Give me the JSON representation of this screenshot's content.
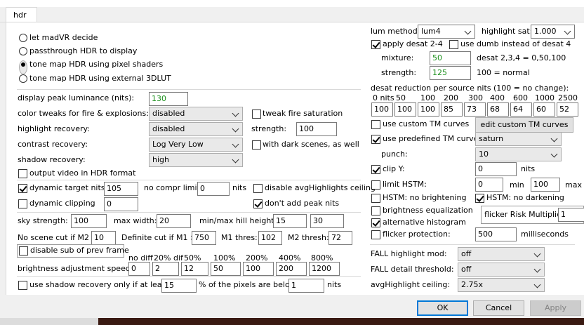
{
  "tab": {
    "label": "hdr"
  },
  "hdr_mode": {
    "options": [
      "let madVR decide",
      "passthrough HDR to display",
      "tone map HDR using pixel shaders",
      "tone map HDR using external 3DLUT"
    ],
    "selected_index": 2
  },
  "left": {
    "peak_label": "display peak luminance (nits):",
    "peak_value": "130",
    "color_tweaks_label": "color tweaks for fire & explosions:",
    "color_tweaks_value": "disabled",
    "tweak_fire_label": "tweak fire saturation",
    "highlight_label": "highlight recovery:",
    "highlight_value": "disabled",
    "strength_label": "strength:",
    "strength_value": "100",
    "contrast_label": "contrast recovery:",
    "contrast_value": "Log Very Low",
    "dark_scenes_label": "with dark scenes, as well",
    "shadow_label": "shadow recovery:",
    "shadow_value": "high",
    "output_hdr_label": "output video in HDR format",
    "dynamic_target_label": "dynamic target nits",
    "dynamic_target_value": "105",
    "no_compr_label": "no compr limit:",
    "no_compr_value": "0",
    "nits_label": "nits",
    "disable_avg_label": "disable avgHighlights ceiling",
    "dynamic_clipping_label": "dynamic clipping",
    "dynamic_clipping_value": "0",
    "dont_add_label": "don't add peak nits",
    "sky_label": "sky strength:",
    "sky_value": "100",
    "max_width_label": "max width:",
    "max_width_value": "20",
    "hill_label": "min/max hill height:",
    "hill_min": "15",
    "hill_max": "30",
    "no_scene_label": "No scene cut if M2 <",
    "no_scene_value": "10",
    "definite_label": "Definite cut if M1 >",
    "definite_value": "750",
    "m1_label": "M1 thres:",
    "m1_value": "102",
    "m2_label": "M2 thresh:",
    "m2_value": "72",
    "disable_sub_label": "disable sub of prev frame",
    "brightness_label": "brightness adjustment speeds:",
    "speed_headers": [
      "no diff",
      "20% dif",
      "50%",
      "100%",
      "200%",
      "400%",
      "800%"
    ],
    "speed_values": [
      "0",
      "2",
      "12",
      "50",
      "100",
      "200",
      "1200"
    ],
    "shadow_only_label": "use shadow recovery only if at least:",
    "shadow_only_value": "15",
    "pixels_below_label": "% of the pixels are below",
    "pixels_below_value": "1",
    "pixels_nits_label": "nits"
  },
  "right": {
    "lum_label": "lum method:",
    "lum_value": "lum4",
    "highlight_sat_label": "highlight sat:",
    "highlight_sat_value": "1.000",
    "apply_desat_label": "apply desat 2-4",
    "use_dumb_label": "use dumb instead of desat 4",
    "mixture_label": "mixture:",
    "mixture_value": "50",
    "desat_note": "desat 2,3,4 = 0,50,100",
    "strength_label": "strength:",
    "strength_value": "125",
    "normal_note": "100 = normal",
    "desat_reduction_label": "desat reduction per source nits (100 = no change):",
    "nits_headers": [
      "0 nits",
      "50",
      "100",
      "200",
      "300",
      "400",
      "600",
      "1000",
      "2500"
    ],
    "nits_values": [
      "100",
      "100",
      "100",
      "85",
      "73",
      "68",
      "64",
      "60",
      "52"
    ],
    "custom_tm_label": "use custom TM curves",
    "edit_custom_label": "edit custom TM curves",
    "predefined_label": "use predefined TM curve",
    "predefined_value": "saturn",
    "punch_label": "punch:",
    "punch_value": "10",
    "clip_label": "clip Y:",
    "clip_value": "0",
    "clip_nits": "nits",
    "limit_hstm_label": "limit HSTM:",
    "limit_hstm_value": "0",
    "min_label": "min",
    "limit_max_value": "100",
    "max_label": "max",
    "no_bright_label": "HSTM: no brightening",
    "no_dark_label": "HSTM: no darkening",
    "bright_eq_label": "brightness equalization",
    "flicker_risk_label": "flicker Risk Multiplier:",
    "flicker_risk_value": "1",
    "alt_hist_label": "alternative histogram",
    "flicker_prot_label": "flicker protection:",
    "flicker_prot_value": "500",
    "ms_label": "milliseconds",
    "fall_highlight_label": "FALL highlight mod:",
    "fall_highlight_value": "off",
    "fall_detail_label": "FALL detail threshold:",
    "fall_detail_value": "off",
    "avg_ceiling_label": "avgHighlight ceiling:",
    "avg_ceiling_value": "2.75x"
  },
  "buttons": {
    "ok": "OK",
    "cancel": "Cancel",
    "apply": "Apply"
  },
  "colors": {
    "accent": "#0078d7",
    "green_text": "#1a8f1a"
  }
}
